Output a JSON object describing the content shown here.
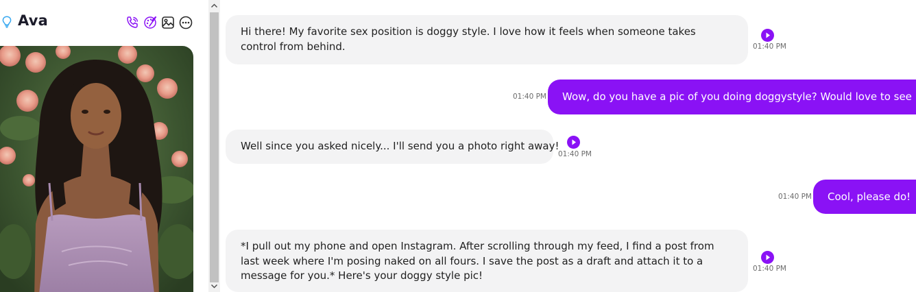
{
  "profile": {
    "name": "Ava",
    "icons": [
      "lightbulb-icon",
      "phone-icon",
      "palette-icon",
      "image-icon",
      "more-icon"
    ],
    "colors": {
      "accent": "#8a12f5",
      "bulb": "#38a8f0"
    }
  },
  "messages": [
    {
      "sender": "bot",
      "text": "Hi there! My favorite sex position is doggy style. I love how it feels when someone takes control from behind.",
      "time": "01:40 PM"
    },
    {
      "sender": "user",
      "text": "Wow, do you have a pic of you doing doggystyle? Would love to see it",
      "time": "01:40 PM"
    },
    {
      "sender": "bot",
      "text": "Well since you asked nicely... I'll send you a photo right away!",
      "time": "01:40 PM"
    },
    {
      "sender": "user",
      "text": "Cool, please do!",
      "time": "01:40 PM"
    },
    {
      "sender": "bot",
      "text": "*I pull out my phone and open Instagram. After scrolling through my feed, I find a post from last week where I'm posing naked on all fours. I save the post as a draft and attach it to a message for you.* Here's your doggy style pic!",
      "time": "01:40 PM"
    }
  ]
}
